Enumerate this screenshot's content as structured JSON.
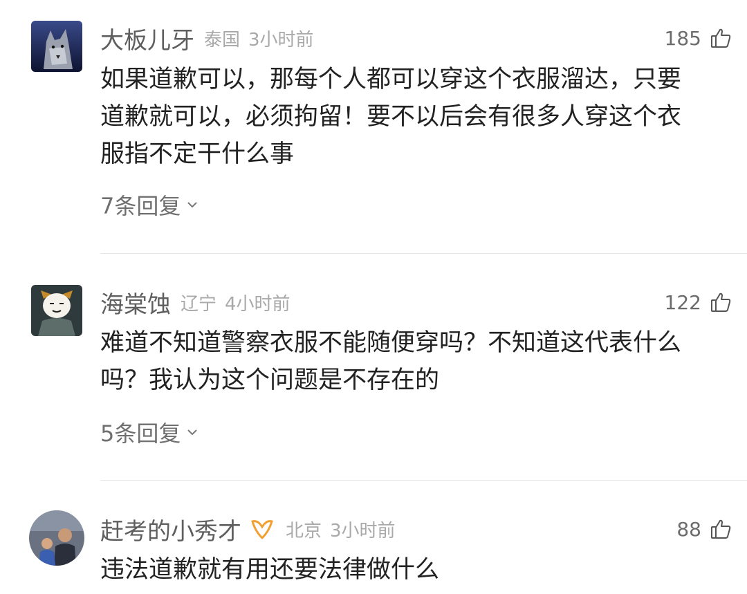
{
  "comments": [
    {
      "username": "大板儿牙",
      "location": "泰国",
      "time": "3小时前",
      "likes": "185",
      "text": [
        "如果道歉可以，那每个人都可以穿这个衣服溜达，只要",
        "道歉就可以，必须拘留！要不以后会有很多人穿这个衣",
        "服指不定干什么事"
      ],
      "replies": "7条回复",
      "avatar_icon": "wolf-avatar-icon"
    },
    {
      "username": "海棠蚀",
      "location": "辽宁",
      "time": "4小时前",
      "likes": "122",
      "text": [
        "难道不知道警察衣服不能随便穿吗？不知道这代表什么",
        "吗？我认为这个问题是不存在的"
      ],
      "replies": "5条回复",
      "avatar_icon": "cartoon-character-avatar-icon"
    },
    {
      "username": "赶考的小秀才",
      "location": "北京",
      "time": "3小时前",
      "likes": "88",
      "text": [
        "违法道歉就有用还要法律做什么"
      ],
      "badge_icon": "orange-ribbon-badge-icon",
      "avatar_icon": "family-photo-avatar-icon"
    }
  ],
  "icons": {
    "like": "thumbs-up-icon",
    "expand": "chevron-down-icon"
  },
  "colors": {
    "username": "#5f5f5f",
    "meta": "#a9a9a9",
    "text": "#222222",
    "badge": "#f0a030"
  }
}
